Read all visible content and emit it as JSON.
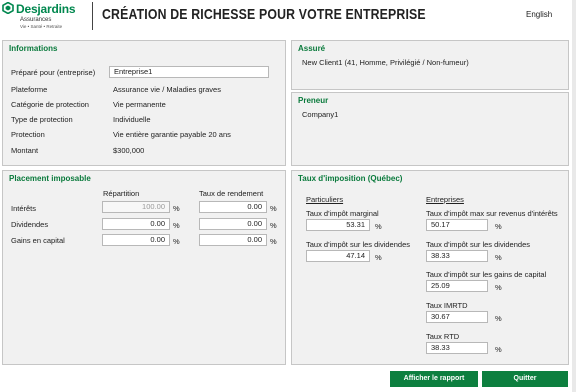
{
  "header": {
    "brand": "Desjardins",
    "brand_sub": "Assurances",
    "brand_tag": "Vie • Santé • Retraite",
    "title": "CRÉATION DE RICHESSE POUR VOTRE ENTREPRISE",
    "language_link": "English"
  },
  "informations": {
    "title": "Informations",
    "prepared_for_label": "Préparé pour (entreprise)",
    "prepared_for_value": "Entreprise1",
    "platform_label": "Plateforme",
    "platform_value": "Assurance vie / Maladies graves",
    "category_label": "Catégorie de protection",
    "category_value": "Vie permanente",
    "type_label": "Type de protection",
    "type_value": "Individuelle",
    "protection_label": "Protection",
    "protection_value": "Vie entière garantie payable 20 ans",
    "amount_label": "Montant",
    "amount_value": "$300,000"
  },
  "assure": {
    "title": "Assuré",
    "value": "New Client1 (41, Homme, Privilégié / Non-fumeur)"
  },
  "preneur": {
    "title": "Preneur",
    "value": "Company1"
  },
  "placement": {
    "title": "Placement imposable",
    "col_repartition": "Répartition",
    "col_rendement": "Taux de rendement",
    "rows": [
      {
        "label": "Intérêts",
        "repartition": "100.00",
        "rendement": "0.00"
      },
      {
        "label": "Dividendes",
        "repartition": "0.00",
        "rendement": "0.00"
      },
      {
        "label": "Gains en capital",
        "repartition": "0.00",
        "rendement": "0.00"
      }
    ],
    "pct": "%"
  },
  "taux": {
    "title": "Taux d'imposition (Québec)",
    "particuliers_header": "Particuliers",
    "entreprises_header": "Entreprises",
    "p_marginal_label": "Taux d'impôt marginal",
    "p_marginal_value": "53.31",
    "p_dividendes_label": "Taux d'impôt sur les dividendes",
    "p_dividendes_value": "47.14",
    "e_interets_label": "Taux d'impôt max sur revenus d'intérêts",
    "e_interets_value": "50.17",
    "e_dividendes_label": "Taux d'impôt sur les dividendes",
    "e_dividendes_value": "38.33",
    "e_gains_label": "Taux d'impôt sur les gains de capital",
    "e_gains_value": "25.09",
    "e_imrtd_label": "Taux IMRTD",
    "e_imrtd_value": "30.67",
    "e_rtd_label": "Taux RTD",
    "e_rtd_value": "38.33",
    "pct": "%"
  },
  "buttons": {
    "report": "Afficher le rapport",
    "quit": "Quitter"
  },
  "colors": {
    "brand_green": "#00874e",
    "button_green": "#0d7f3f",
    "panel_bg": "#f1f1f1"
  }
}
